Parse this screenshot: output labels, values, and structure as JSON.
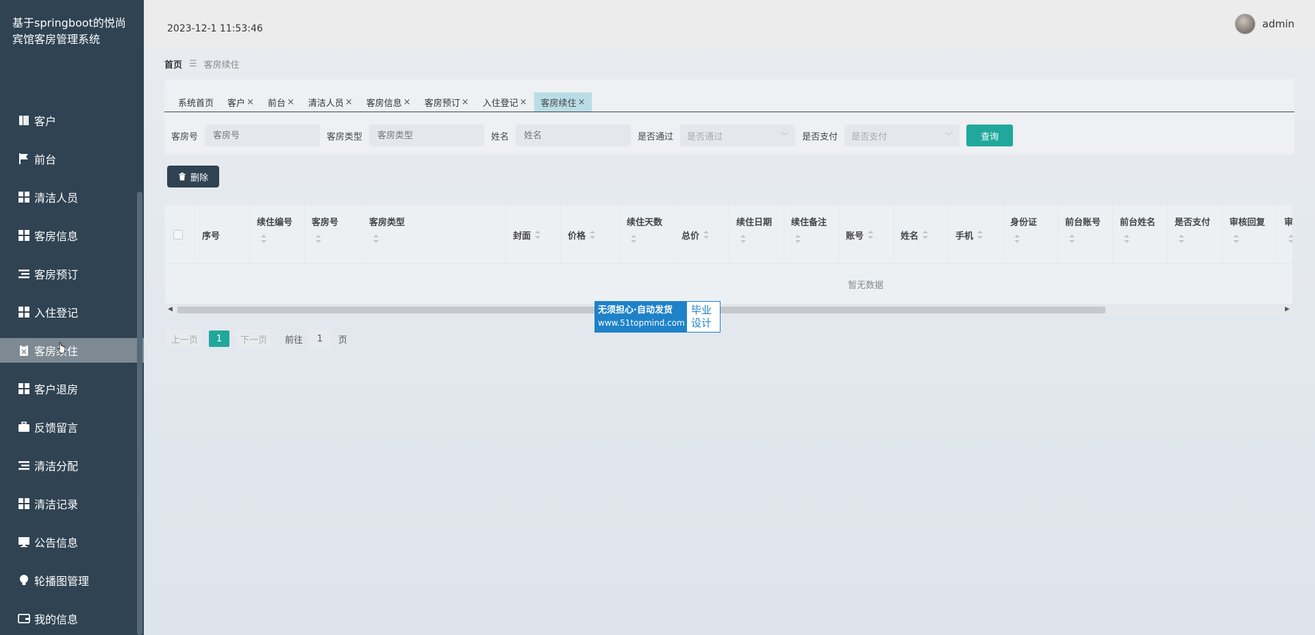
{
  "app": {
    "title": "基于springboot的悦尚宾馆客房管理系统"
  },
  "header": {
    "datetime": "2023-12-1 11:53:46",
    "username": "admin"
  },
  "sidebar": {
    "items": [
      {
        "label": "客户",
        "icon": "book-icon"
      },
      {
        "label": "前台",
        "icon": "flag-icon"
      },
      {
        "label": "清洁人员",
        "icon": "grid-icon"
      },
      {
        "label": "客房信息",
        "icon": "grid-icon"
      },
      {
        "label": "客房预订",
        "icon": "list-icon"
      },
      {
        "label": "入住登记",
        "icon": "grid-icon"
      },
      {
        "label": "客房续住",
        "icon": "clipboard-icon",
        "active": true
      },
      {
        "label": "客户退房",
        "icon": "grid-icon"
      },
      {
        "label": "反馈留言",
        "icon": "briefcase-icon"
      },
      {
        "label": "清洁分配",
        "icon": "list-icon"
      },
      {
        "label": "清洁记录",
        "icon": "grid-icon"
      },
      {
        "label": "公告信息",
        "icon": "monitor-icon"
      },
      {
        "label": "轮播图管理",
        "icon": "bulb-icon"
      },
      {
        "label": "我的信息",
        "icon": "wallet-icon"
      }
    ]
  },
  "breadcrumb": {
    "home": "首页",
    "separator": "☰",
    "current": "客房续住"
  },
  "tabs": [
    {
      "label": "系统首页",
      "closable": false
    },
    {
      "label": "客户",
      "closable": true
    },
    {
      "label": "前台",
      "closable": true
    },
    {
      "label": "清洁人员",
      "closable": true
    },
    {
      "label": "客房信息",
      "closable": true
    },
    {
      "label": "客房预订",
      "closable": true
    },
    {
      "label": "入住登记",
      "closable": true
    },
    {
      "label": "客房续住",
      "closable": true,
      "active": true
    }
  ],
  "tab_close": "×",
  "search": {
    "room_no_label": "客房号",
    "room_no_placeholder": "客房号",
    "room_type_label": "客房类型",
    "room_type_placeholder": "客房类型",
    "name_label": "姓名",
    "name_placeholder": "姓名",
    "approved_label": "是否通过",
    "approved_placeholder": "是否通过",
    "paid_label": "是否支付",
    "paid_placeholder": "是否支付",
    "query_button": "查询"
  },
  "delete_button": "删除",
  "table": {
    "columns": [
      {
        "label": "序号",
        "sortable": false,
        "layout": "mid"
      },
      {
        "label": "续住编号",
        "sortable": true,
        "layout": "stack"
      },
      {
        "label": "客房号",
        "sortable": true,
        "layout": "stack"
      },
      {
        "label": "客房类型",
        "sortable": true,
        "layout": "stack"
      },
      {
        "label": "封面",
        "sortable": true,
        "layout": "mid"
      },
      {
        "label": "价格",
        "sortable": true,
        "layout": "mid"
      },
      {
        "label": "续住天数",
        "sortable": true,
        "layout": "stack"
      },
      {
        "label": "总价",
        "sortable": true,
        "layout": "mid"
      },
      {
        "label": "续住日期",
        "sortable": true,
        "layout": "stack"
      },
      {
        "label": "续住备注",
        "sortable": true,
        "layout": "stack"
      },
      {
        "label": "账号",
        "sortable": true,
        "layout": "mid"
      },
      {
        "label": "姓名",
        "sortable": true,
        "layout": "mid"
      },
      {
        "label": "手机",
        "sortable": true,
        "layout": "mid"
      },
      {
        "label": "身份证",
        "sortable": true,
        "layout": "stack"
      },
      {
        "label": "前台账号",
        "sortable": true,
        "layout": "stack"
      },
      {
        "label": "前台姓名",
        "sortable": true,
        "layout": "stack"
      },
      {
        "label": "是否支付",
        "sortable": true,
        "layout": "stack"
      },
      {
        "label": "审核回复",
        "sortable": true,
        "layout": "stack"
      },
      {
        "label": "审核状态",
        "sortable": true,
        "layout": "stack"
      }
    ],
    "empty_text": "暂无数据"
  },
  "pager": {
    "prev": "上一页",
    "current": "1",
    "next": "下一页",
    "goto_label": "前往",
    "goto_value": "1",
    "page_suffix": "页"
  },
  "watermark": {
    "line1": "无须担心·自动发货",
    "line2": "www.51topmind.com",
    "right1": "毕业",
    "right2": "设计"
  }
}
